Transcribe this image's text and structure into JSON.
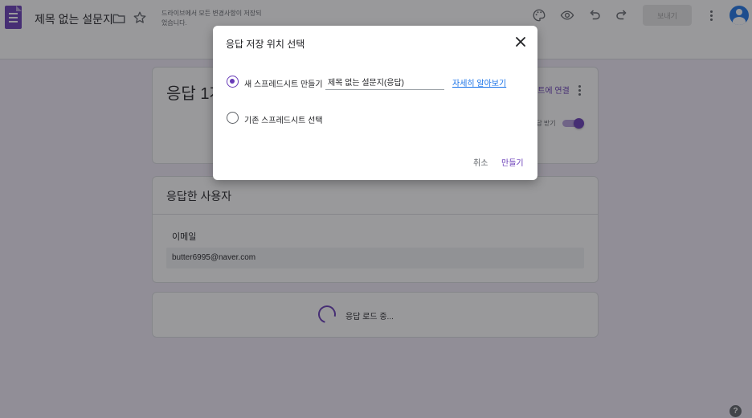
{
  "header": {
    "title": "제목 없는 설문지",
    "save_status": "드라이브에서 모든 변경사항이 저장되었습니다.",
    "send_label": "보내기",
    "icons": [
      "folder-icon",
      "star-icon",
      "palette-icon",
      "eye-icon",
      "undo-icon",
      "redo-icon",
      "more-vert-icon",
      "account-icon"
    ]
  },
  "summary": {
    "response_count": "응답 1개",
    "sheets_link": "시트에 연결",
    "accept_label": "응답 받기",
    "accepting": true
  },
  "respondents": {
    "title": "응답한 사용자",
    "email_label": "이메일",
    "email_value": "butter6995@naver.com"
  },
  "loading": {
    "text": "응답 로드 중..."
  },
  "dialog": {
    "title": "응답 저장 위치 선택",
    "option_new_label": "새 스프레드시트 만들기",
    "sheet_name_value": "제목 없는 설문지(응답)",
    "learn_more": "자세히 알아보기",
    "option_existing_label": "기존 스프레드시트 선택",
    "selected_option": "new",
    "cancel_label": "취소",
    "create_label": "만들기"
  },
  "colors": {
    "accent": "#673ab7",
    "link": "#1a73e8",
    "background": "#f0ebf8"
  },
  "help_glyph": "?"
}
